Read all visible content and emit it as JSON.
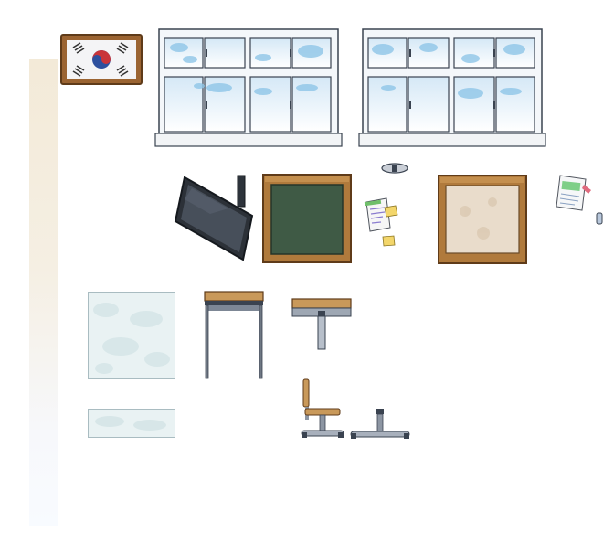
{
  "sheet": {
    "kind": "classroom tileset",
    "colors": {
      "wood": "#b07a3c",
      "wood_dark": "#7a4f22",
      "chalkboard": "#3f5a45",
      "corkboard": "#e9dccb",
      "window_frame": "#eef3f8",
      "glass": "#cfe6f5",
      "metal": "#8d96a3",
      "wall": "#f3ead8"
    }
  }
}
